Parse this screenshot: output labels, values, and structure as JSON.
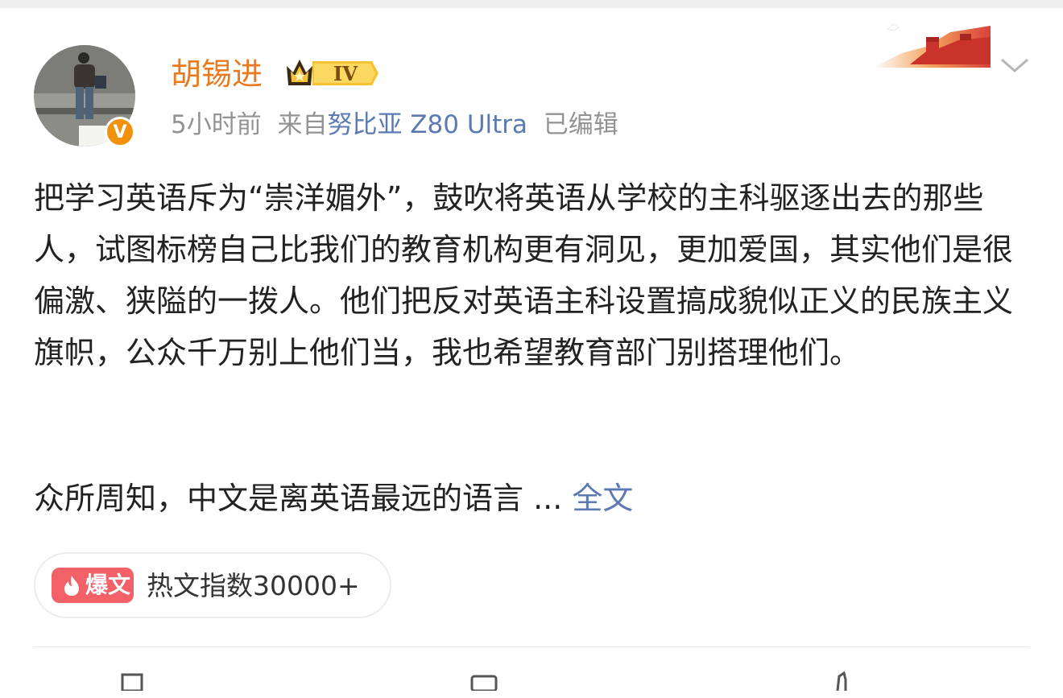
{
  "post": {
    "author": "胡锡进",
    "level": "IV",
    "time": "5小时前",
    "source_prefix": "来自",
    "source_device": "努比亚 Z80 Ultra",
    "edited": "已编辑",
    "paragraph1": "把学习英语斥为“崇洋媚外”，鼓吹将英语从学校的主科驱逐出去的那些人，试图标榜自己比我们的教育机构更有洞见，更加爱国，其实他们是很偏激、狭隘的一拨人。他们把反对英语主科设置搞成貌似正义的民族主义旗帜，公众千万别上他们当，我也希望教育部门别搭理他们。",
    "paragraph2": "众所周知，中文是离英语最远的语言 ... ",
    "read_more": "全文",
    "hot_badge": "爆文",
    "hot_index": "热文指数30000+",
    "verified_badge": "V"
  },
  "icons": {
    "verified": "verified-v-icon",
    "level": "crown-level-icon",
    "more": "chevron-down-icon",
    "hot": "flame-icon",
    "repost": "repost-icon",
    "comment": "comment-icon",
    "like": "like-icon"
  },
  "colors": {
    "username": "#e87a1f",
    "link": "#5b7ab4",
    "meta": "#939393",
    "hot_badge": "#f26068",
    "verified": "#f2920c"
  }
}
